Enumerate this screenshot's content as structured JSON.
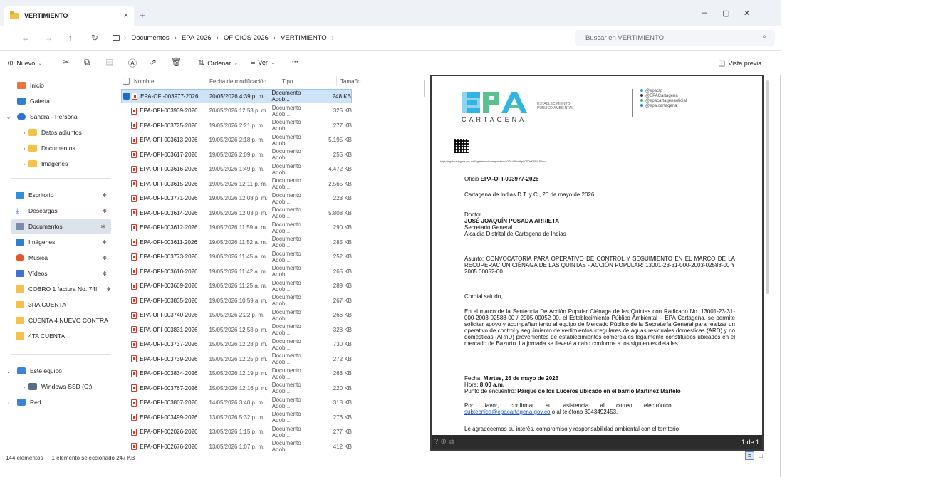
{
  "tab": {
    "title": "VERTIMIENTO",
    "close": "×",
    "new": "+"
  },
  "window_controls": {
    "minimize": "–",
    "restore": "▢",
    "close": "✕"
  },
  "nav": {
    "back": "←",
    "forward": "→",
    "up": "↑",
    "refresh": "↻"
  },
  "breadcrumb": [
    "Documentos",
    "EPA 2026",
    "OFICIOS 2026",
    "VERTIMIENTO"
  ],
  "search": {
    "placeholder": "Buscar en VERTIMIENTO"
  },
  "commands": {
    "new": "Nuevo",
    "sort": "Ordenar",
    "view": "Ver",
    "more": "···",
    "preview": "Vista previa"
  },
  "sidebar": {
    "home": "Inicio",
    "gallery": "Galería",
    "cloud": "Sandra - Personal",
    "cloud_children": [
      "Datos adjuntos",
      "Documentos",
      "Imágenes"
    ],
    "pinned": [
      "Escritorio",
      "Descargas",
      "Documentos",
      "Imágenes",
      "Música",
      "Vídeos",
      "COBRO 1 factura No. 74!",
      "3RA CUENTA",
      "CUENTA 4 NUEVO CONTRA",
      "4TA CUENTA"
    ],
    "this_pc": "Este equipo",
    "drive": "Windows-SSD (C:)",
    "network": "Red"
  },
  "columns": {
    "name": "Nombre",
    "date": "Fecha de modificación",
    "type": "Tipo",
    "size": "Tamaño"
  },
  "files": [
    {
      "name": "EPA-OFI-003977-2026",
      "date": "20/05/2026 4:39 p. m.",
      "type": "Documento Adob...",
      "size": "248 KB"
    },
    {
      "name": "EPA-OFI-003939-2026",
      "date": "20/05/2026 12:53 p. m.",
      "type": "Documento Adob...",
      "size": "325 KB"
    },
    {
      "name": "EPA-OFI-003725-2026",
      "date": "19/05/2026 2:21 p. m.",
      "type": "Documento Adob...",
      "size": "277 KB"
    },
    {
      "name": "EPA-OFI-003613-2026",
      "date": "19/05/2026 2:18 p. m.",
      "type": "Documento Adob...",
      "size": "5.195 KB"
    },
    {
      "name": "EPA-OFI-003617-2026",
      "date": "19/05/2026 2:09 p. m.",
      "type": "Documento Adob...",
      "size": "255 KB"
    },
    {
      "name": "EPA-OFI-003616-2026",
      "date": "19/05/2026 1:49 p. m.",
      "type": "Documento Adob...",
      "size": "4.472 KB"
    },
    {
      "name": "EPA-OFI-003615-2026",
      "date": "19/05/2026 12:11 p. m.",
      "type": "Documento Adob...",
      "size": "2.565 KB"
    },
    {
      "name": "EPA-OFI-003771-2026",
      "date": "19/05/2026 12:08 p. m.",
      "type": "Documento Adob...",
      "size": "223 KB"
    },
    {
      "name": "EPA-OFI-003614-2026",
      "date": "19/05/2026 12:03 p. m.",
      "type": "Documento Adob...",
      "size": "5.808 KB"
    },
    {
      "name": "EPA-OFI-003612-2026",
      "date": "19/05/2026 11:59 a. m.",
      "type": "Documento Adob...",
      "size": "290 KB"
    },
    {
      "name": "EPA-OFI-003611-2026",
      "date": "19/05/2026 11:52 a. m.",
      "type": "Documento Adob...",
      "size": "285 KB"
    },
    {
      "name": "EPA-OFI-003773-2026",
      "date": "19/05/2026 11:45 a. m.",
      "type": "Documento Adob...",
      "size": "252 KB"
    },
    {
      "name": "EPA-OFI-003610-2026",
      "date": "19/05/2026 11:42 a. m.",
      "type": "Documento Adob...",
      "size": "265 KB"
    },
    {
      "name": "EPA-OFI-003609-2026",
      "date": "19/05/2026 11:25 a. m.",
      "type": "Documento Adob...",
      "size": "289 KB"
    },
    {
      "name": "EPA-OFI-003835-2026",
      "date": "19/05/2026 10:59 a. m.",
      "type": "Documento Adob...",
      "size": "267 KB"
    },
    {
      "name": "EPA-OFI-003740-2026",
      "date": "15/05/2026 2:22 p. m.",
      "type": "Documento Adob...",
      "size": "266 KB"
    },
    {
      "name": "EPA-OFI-003831-2026",
      "date": "15/05/2026 12:58 p. m.",
      "type": "Documento Adob...",
      "size": "328 KB"
    },
    {
      "name": "EPA-OFI-003737-2026",
      "date": "15/05/2026 12:28 p. m.",
      "type": "Documento Adob...",
      "size": "730 KB"
    },
    {
      "name": "EPA-OFI-003739-2026",
      "date": "15/05/2026 12:25 p. m.",
      "type": "Documento Adob...",
      "size": "272 KB"
    },
    {
      "name": "EPA-OFI-003834-2026",
      "date": "15/05/2026 12:19 p. m.",
      "type": "Documento Adob...",
      "size": "263 KB"
    },
    {
      "name": "EPA-OFI-003767-2026",
      "date": "15/05/2026 12:16 p. m.",
      "type": "Documento Adob...",
      "size": "220 KB"
    },
    {
      "name": "EPA-OFI-003807-2026",
      "date": "14/05/2026 3:40 p. m.",
      "type": "Documento Adob...",
      "size": "318 KB"
    },
    {
      "name": "EPA-OFI-003499-2026",
      "date": "13/05/2026 5:32 p. m.",
      "type": "Documento Adob...",
      "size": "276 KB"
    },
    {
      "name": "EPA-OFI-002026-2026",
      "date": "13/05/2026 1:15 p. m.",
      "type": "Documento Adob...",
      "size": "277 KB"
    },
    {
      "name": "EPA-OFI-002676-2026",
      "date": "13/05/2026 1:07 p. m.",
      "type": "Documento Adob...",
      "size": "412 KB"
    }
  ],
  "status": {
    "count": "144 elementos",
    "selection": "1 elemento seleccionado  247 KB"
  },
  "preview": {
    "page": "1 de 1",
    "logo_text": "CARTAGENA",
    "logo_entity": "ESTABLECIMIENTO PÚBLICO AMBIENTAL",
    "social": [
      "@epactg",
      "@EPACartagena",
      "@epacartagenaoficial",
      "@epa.cartagena"
    ],
    "qr_url": "https://sigob.cartagena.gov.co/SeguimientoCorrespondencia?ID=4YPcuIffp9OSOxKRB41S5w==",
    "oficio_label": "Oficio ",
    "oficio_number": "EPA-OFI-003977-2026",
    "place_date": "Cartagena de Indias D.T. y C., 20 de mayo de 2026",
    "salutation_title": "Doctor",
    "recipient": "JOSÉ JOAQUÍN POSADA ARRIETA",
    "recipient_role": "Secretario General",
    "recipient_org": "Alcaldía Distrital de Cartagena de Indias",
    "subject": "Asunto: CONVOCATORIA PARA OPERATIVO DE CONTROL Y SEGUIMIENTO EN EL MARCO DE LA RECUPERACIÓN CIÉNAGA DE LAS QUINTAS - ACCIÓN POPULAR: 13001-23-31-000-2003-02588-00 Y 2005 00052-00.",
    "greeting": "Cordial saludo,",
    "body": "En el marco de la Sentencia De Acción Popular Ciénaga de las Quintas con Radicado No. 13001-23-31-000-2003-02588-00 / 2005-00052-00, el Establecimiento Público Ambiental – EPA Cartagena, se permite solicitar apoyo y acompañamiento al equipo de Mercado Público de la Secretaría General para realizar un operativo de control y seguimiento de vertimientos irregulares de aguas residuales domesticas (ARD) y no domesticas (ARnD) provenientes de establecimientos comerciales legalmente constituidos ubicados en el mercado de Bazurto. La jornada se llevará a cabo conforme a los siguientes detalles:",
    "date_label": "Fecha: ",
    "date_value": "Martes, 26 de mayo de 2026",
    "time_label": "Hora: ",
    "time_value": "8:00 a.m.",
    "place_label": "Punto de encuentro: ",
    "place_value": "Parque de los Luceros ubicado en el barrio Martínez Martelo",
    "confirm_text": "Por favor, confirmar su asistencia al correo electrónico",
    "email": "subtecnica@epacartagena.gov.co",
    "phone_text": " o al teléfono 3043492453.",
    "closing": "Le agradecemos su interés, compromiso y responsabilidad ambiental con el territorio"
  }
}
